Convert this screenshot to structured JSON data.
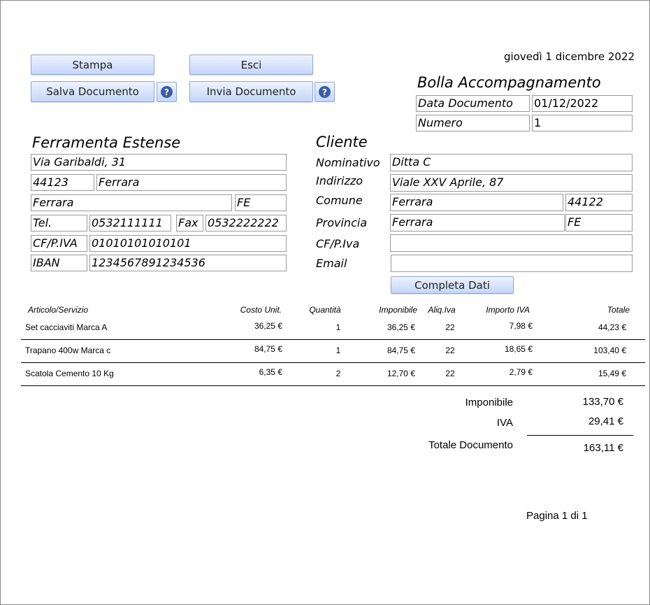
{
  "date": "giovedì 1 dicembre 2022",
  "buttons": {
    "print": "Stampa",
    "exit": "Esci",
    "save": "Salva Documento",
    "send": "Invia Documento",
    "complete": "Completa Dati",
    "help": "?"
  },
  "document": {
    "title": "Bolla Accompagnamento",
    "date_label": "Data Documento",
    "date_value": "01/12/2022",
    "number_label": "Numero",
    "number_value": "1"
  },
  "company": {
    "name": "Ferramenta Estense",
    "address": "Via Garibaldi, 31",
    "cap": "44123",
    "city": "Ferrara",
    "comune": "Ferrara",
    "province": "FE",
    "tel_label": "Tel.",
    "tel": "0532111111",
    "fax_label": "Fax",
    "fax": "0532222222",
    "vat_label": "CF/P.IVA",
    "vat": "01010101010101",
    "iban_label": "IBAN",
    "iban": "1234567891234536"
  },
  "client": {
    "title": "Cliente",
    "name_label": "Nominativo",
    "name": "Ditta C",
    "address_label": "Indirizzo",
    "address": "Viale XXV Aprile, 87",
    "comune_label": "Comune",
    "comune": "Ferrara",
    "cap": "44122",
    "province_label": "Provincia",
    "province": "Ferrara",
    "province_code": "FE",
    "vat_label": "CF/P.Iva",
    "vat": "",
    "email_label": "Email",
    "email": ""
  },
  "table": {
    "headers": [
      "Articolo/Servizio",
      "Costo Unit.",
      "Quantità",
      "Imponibile",
      "Aliq.Iva",
      "Importo IVA",
      "Totale"
    ],
    "rows": [
      [
        "Set cacciaviti Marca A",
        "36,25 €",
        "1",
        "36,25 €",
        "22",
        "7,98 €",
        "44,23 €"
      ],
      [
        "Trapano 400w Marca c",
        "84,75 €",
        "1",
        "84,75 €",
        "22",
        "18,65 €",
        "103,40 €"
      ],
      [
        "Scatola Cemento 10 Kg",
        "6,35 €",
        "2",
        "12,70 €",
        "22",
        "2,79 €",
        "15,49 €"
      ]
    ]
  },
  "totals": {
    "taxable_label": "Imponibile",
    "taxable": "133,70 €",
    "vat_label": "IVA",
    "vat": "29,41 €",
    "total_label": "Totale Documento",
    "total": "163,11 €"
  },
  "page": "Pagina 1 di 1"
}
